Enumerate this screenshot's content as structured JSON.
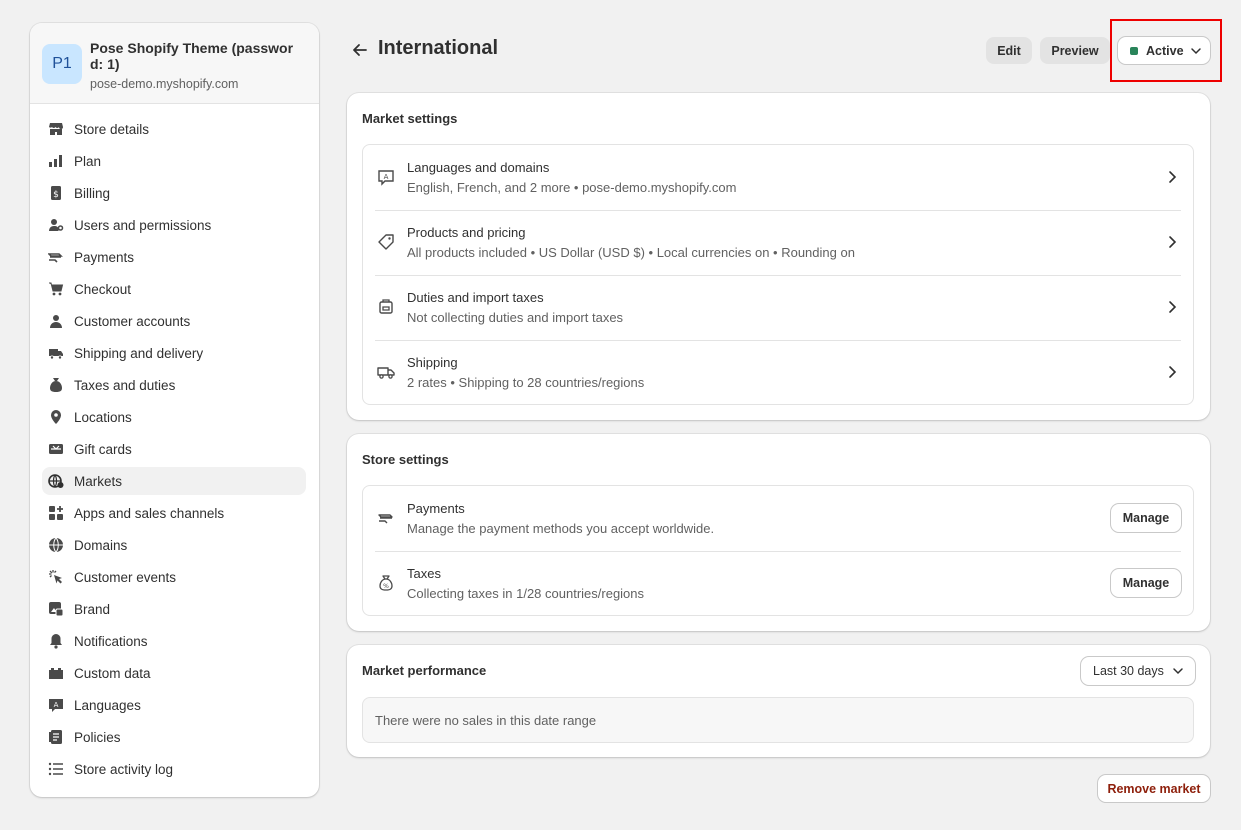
{
  "store": {
    "avatar": "P1",
    "name": "Pose Shopify Theme (password: 1)",
    "domain": "pose-demo.myshopify.com"
  },
  "nav": [
    {
      "label": "Store details",
      "icon": "store-icon"
    },
    {
      "label": "Plan",
      "icon": "plan-icon"
    },
    {
      "label": "Billing",
      "icon": "billing-icon"
    },
    {
      "label": "Users and permissions",
      "icon": "users-icon"
    },
    {
      "label": "Payments",
      "icon": "payments-icon"
    },
    {
      "label": "Checkout",
      "icon": "cart-icon"
    },
    {
      "label": "Customer accounts",
      "icon": "person-icon"
    },
    {
      "label": "Shipping and delivery",
      "icon": "truck-icon"
    },
    {
      "label": "Taxes and duties",
      "icon": "money-bag-icon"
    },
    {
      "label": "Locations",
      "icon": "location-icon"
    },
    {
      "label": "Gift cards",
      "icon": "gift-card-icon"
    },
    {
      "label": "Markets",
      "icon": "globe-dollar-icon",
      "active": true
    },
    {
      "label": "Apps and sales channels",
      "icon": "apps-icon"
    },
    {
      "label": "Domains",
      "icon": "globe-icon"
    },
    {
      "label": "Customer events",
      "icon": "cursor-click-icon"
    },
    {
      "label": "Brand",
      "icon": "brand-icon"
    },
    {
      "label": "Notifications",
      "icon": "bell-icon"
    },
    {
      "label": "Custom data",
      "icon": "custom-data-icon"
    },
    {
      "label": "Languages",
      "icon": "language-icon"
    },
    {
      "label": "Policies",
      "icon": "policies-icon"
    },
    {
      "label": "Store activity log",
      "icon": "list-icon"
    }
  ],
  "header": {
    "title": "International",
    "edit_label": "Edit",
    "preview_label": "Preview",
    "status_label": "Active",
    "status_color": "#29845a"
  },
  "market_settings": {
    "title": "Market settings",
    "rows": [
      {
        "title": "Languages and domains",
        "subtitle": "English, French, and 2 more • pose-demo.myshopify.com",
        "icon": "language-icon"
      },
      {
        "title": "Products and pricing",
        "subtitle": "All products included • US Dollar (USD $) • Local currencies on • Rounding on",
        "icon": "price-tag-icon"
      },
      {
        "title": "Duties and import taxes",
        "subtitle": "Not collecting duties and import taxes",
        "icon": "duties-icon"
      },
      {
        "title": "Shipping",
        "subtitle": "2 rates • Shipping to 28 countries/regions",
        "icon": "truck-icon"
      }
    ]
  },
  "store_settings": {
    "title": "Store settings",
    "rows": [
      {
        "title": "Payments",
        "subtitle": "Manage the payment methods you accept worldwide.",
        "button": "Manage",
        "icon": "payments-icon"
      },
      {
        "title": "Taxes",
        "subtitle": "Collecting taxes in 1/28 countries/regions",
        "button": "Manage",
        "icon": "money-bag-icon"
      }
    ]
  },
  "performance": {
    "title": "Market performance",
    "range_label": "Last 30 days",
    "empty_text": "There were no sales in this date range"
  },
  "remove_label": "Remove market"
}
